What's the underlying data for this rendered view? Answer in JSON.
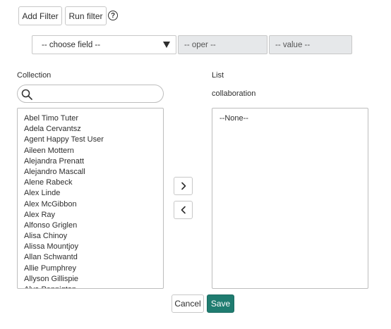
{
  "toolbar": {
    "add_filter": "Add Filter",
    "run_filter": "Run filter",
    "help_glyph": "?"
  },
  "filter": {
    "field": "-- choose field --",
    "oper": "-- oper --",
    "value": "-- value --"
  },
  "collection": {
    "label": "Collection",
    "search_value": "",
    "items": [
      "Abel Timo Tuter",
      "Adela Cervantsz",
      "Agent Happy Test User",
      "Aileen Mottern",
      "Alejandra Prenatt",
      "Alejandro Mascall",
      "Alene Rabeck",
      "Alex Linde",
      "Alex McGibbon",
      "Alex Ray",
      "Alfonso Griglen",
      "Alisa Chinoy",
      "Alissa Mountjoy",
      "Allan Schwantd",
      "Allie Pumphrey",
      "Allyson Gillispie",
      "Alva Pennigton"
    ]
  },
  "list": {
    "label": "List",
    "name": "collaboration",
    "items": [
      "--None--"
    ]
  },
  "actions": {
    "cancel": "Cancel",
    "save": "Save"
  },
  "icons": {
    "help": "question-circle-icon",
    "caret": "caret-down-icon",
    "search": "search-icon",
    "move_right": "chevron-right-icon",
    "move_left": "chevron-left-icon"
  },
  "colors": {
    "save_bg": "#1f7c70",
    "disabled_bg": "#e6e8ea"
  }
}
